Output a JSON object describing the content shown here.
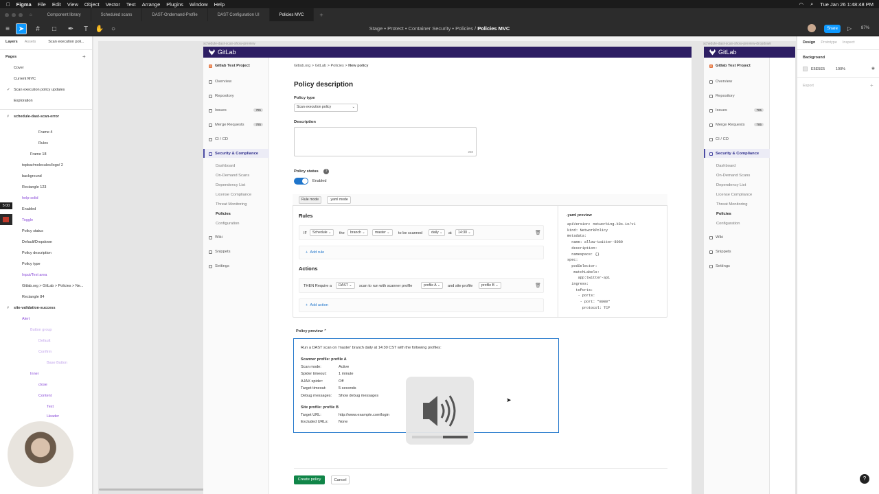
{
  "menubar": {
    "apple": "",
    "items": [
      "Figma",
      "File",
      "Edit",
      "View",
      "Object",
      "Vector",
      "Text",
      "Arrange",
      "Plugins",
      "Window",
      "Help"
    ],
    "clock": "Tue Jan 26  1:48:48 PM"
  },
  "tabs": [
    "Component library",
    "Scheduled scans",
    "DAST-Ondemand-Profile",
    "DAST Configuration UI",
    "Policies MVC"
  ],
  "toolbar": {
    "breadcrumb_path": "Stage • Protect • Container Security • Policies  /",
    "breadcrumb_file": "Policies MVC",
    "share": "Share",
    "zoom": "87%"
  },
  "left_panel": {
    "tabs": [
      "Layers",
      "Assets"
    ],
    "page_title": "Scan execution poli...",
    "pages_header": "Pages",
    "pages": [
      "Cover",
      "Current MVC",
      "Scan execution policy updates",
      "Exploration"
    ],
    "layers": [
      "schedule-dast-scan-error",
      "Frame 4",
      "Rules",
      "Frame 18",
      "topbar/molecules/logo/ 2",
      "background",
      "Rectangle 123",
      "help-solid",
      "Enabled",
      "Toggle",
      "Policy status",
      "Default/Dropdown",
      "Policy description",
      "Policy type",
      "Input/Text area",
      "Gitlab.org > GitLab > Policies > Ne...",
      "Rectangle 84",
      "site-validation-success",
      "Alert",
      "Button group",
      "Default",
      "Confirm",
      "Base Button",
      "Inner",
      "close",
      "Content",
      "Text",
      "Header"
    ],
    "timer": "5:00"
  },
  "frames": {
    "left_label": "schedule-dast-scan-show-preview",
    "right_label": "schedule-dast-scan-show-preview-dropdown"
  },
  "gitlab": {
    "logo": "GitLab",
    "project": "Gitlab Test Project",
    "nav": [
      "Overview",
      "Repository",
      "Issues",
      "Merge Requests",
      "CI / CD",
      "Security & Compliance"
    ],
    "issues_count": "785",
    "mr_count": "785",
    "sub_nav": [
      "Dashboard",
      "On-Demand Scans",
      "Dependency List",
      "License Compliance",
      "Threat Monitoring",
      "Policies",
      "Configuration"
    ],
    "nav_bottom": [
      "Wiki",
      "Snippets",
      "Settings"
    ],
    "breadcrumb": "Gitlab.org > GitLab > Policies > ",
    "breadcrumb_current": "New policy",
    "heading": "Policy description",
    "policy_type_label": "Policy type",
    "policy_type_value": "Scan execution policy",
    "description_label": "Description",
    "char_count": "250",
    "policy_status_label": "Policy status",
    "enabled": "Enabled",
    "mode_tabs": [
      "Rule mode",
      ".yaml mode"
    ],
    "rules_heading": "Rules",
    "rule": {
      "if": "IF",
      "schedule": "Schedule",
      "the": "the",
      "branch": "branch",
      "master": "master",
      "to_be": "to be scanned",
      "daily": "daily",
      "at": "at",
      "time": "14:30"
    },
    "add_rule": "Add rule",
    "actions_heading": "Actions",
    "action": {
      "then": "THEN Require a",
      "dast": "DAST",
      "scan_text": "scan to run with scanner profile",
      "profile_a": "profile A",
      "site_text": "and site profile",
      "profile_b": "profile B"
    },
    "add_action": "Add action",
    "yaml_preview_label": ".yaml preview",
    "yaml": "apiVersion: networking.k8s.io/v1\nkind: NetworkPolicy\nmetadata:\n  name: allow-twitter-8080\n  description:\n  namespace: {}\nspec:\n  podSelector:\n   matchLabels:\n     app:twitter-api\n  ingress:\n    toPorts:\n     - ports:\n      - port: \"8080\"\n       protocol: TCP",
    "policy_preview_label": "Policy preview",
    "preview_intro": "Run a DAST scan on 'master' branch daily at 14:30 CST with the following profiles:",
    "scanner_heading": "Scanner profile: profile A",
    "scanner_rows": [
      {
        "k": "Scan mode:",
        "v": "Active"
      },
      {
        "k": "Spider timeout:",
        "v": "1 minute"
      },
      {
        "k": "AJAX spider:",
        "v": "Off"
      },
      {
        "k": "Target timeout:",
        "v": "5 seconds"
      },
      {
        "k": "Debug messages:",
        "v": "Show debug messages"
      }
    ],
    "site_heading": "Site profile: profile B",
    "site_rows": [
      {
        "k": "Target URL:",
        "v": "http://www.example.com/login"
      },
      {
        "k": "Excluded URLs:",
        "v": "None"
      }
    ],
    "create_btn": "Create policy",
    "cancel_btn": "Cancel"
  },
  "right_panel": {
    "tabs": [
      "Design",
      "Prototype",
      "Inspect"
    ],
    "background_label": "Background",
    "bg_hex": "E5E5E5",
    "bg_opacity": "100%",
    "export_label": "Export"
  },
  "volume_level": 0.55,
  "help": "?"
}
